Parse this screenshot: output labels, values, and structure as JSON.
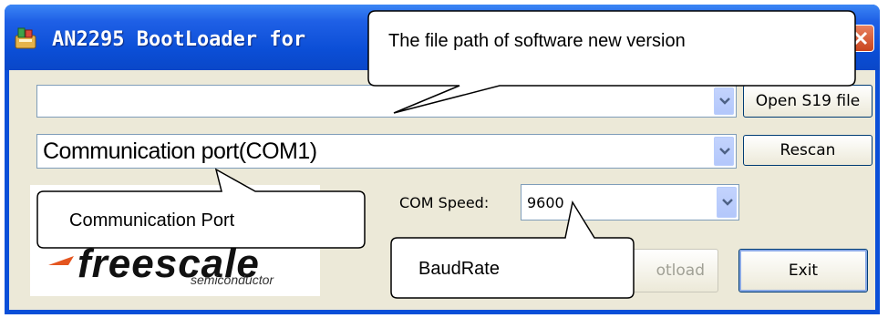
{
  "window": {
    "title": "AN2295 BootLoader for",
    "app_icon": "app-icon",
    "controls": {
      "maximize_icon": "maximize-icon",
      "close_icon": "close-icon"
    }
  },
  "file_path": {
    "value": "",
    "open_button": "Open S19 file"
  },
  "comm_port": {
    "value": "Communication port(COM1)",
    "rescan_button": "Rescan"
  },
  "speed": {
    "label": "COM Speed:",
    "value": "9600"
  },
  "buttons": {
    "bootload": "otload",
    "exit": "Exit"
  },
  "logo": {
    "word": "freescale",
    "sub": "semiconductor"
  },
  "callouts": {
    "file_path": "The file path of software new version",
    "comm_port": "Communication Port",
    "baudrate": "BaudRate"
  },
  "colors": {
    "title_bar": "#0a4fd8",
    "client_bg": "#ece9d8",
    "close_button": "#c9441d",
    "logo_mark": "#e4551f"
  }
}
